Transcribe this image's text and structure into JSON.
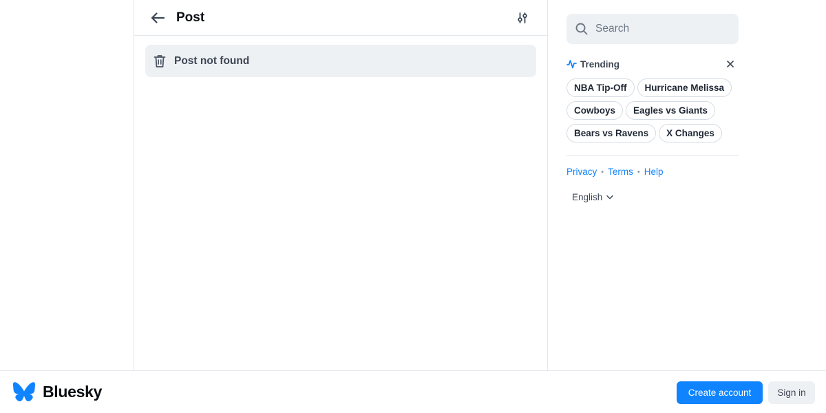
{
  "header": {
    "title": "Post",
    "back_icon": "arrow-left-icon",
    "settings_icon": "sliders-icon"
  },
  "main": {
    "not_found_text": "Post not found",
    "not_found_icon": "trash-icon"
  },
  "search": {
    "placeholder": "Search",
    "value": ""
  },
  "trending": {
    "label": "Trending",
    "icon": "trending-pulse-icon",
    "topics": [
      "NBA Tip-Off",
      "Hurricane Melissa",
      "Cowboys",
      "Eagles vs Giants",
      "Bears vs Ravens",
      "X Changes"
    ]
  },
  "footer": {
    "links": [
      "Privacy",
      "Terms",
      "Help"
    ],
    "language": "English"
  },
  "bottom_bar": {
    "brand": "Bluesky",
    "create_account": "Create account",
    "sign_in": "Sign in"
  },
  "colors": {
    "accent": "#1083fe",
    "panel_bg": "#eef1f4",
    "border": "#e3e8ed"
  }
}
